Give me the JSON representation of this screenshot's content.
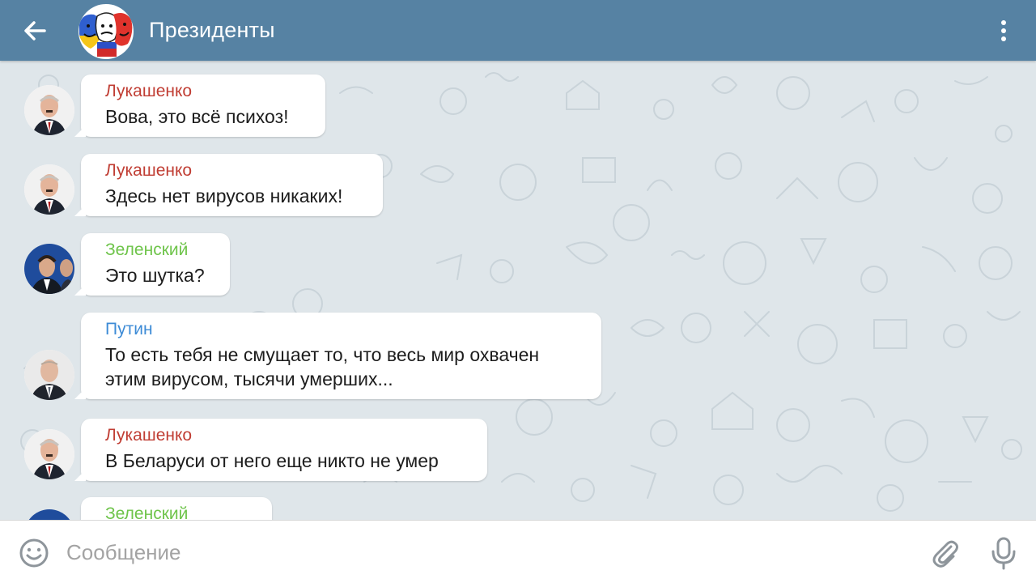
{
  "header": {
    "title": "Президенты",
    "back_icon": "arrow-left-icon",
    "menu_icon": "more-vertical-icon"
  },
  "messages": [
    {
      "sender": "Лукашенко",
      "sender_color": "#c03d33",
      "avatar": "lukashenko-avatar",
      "lines": [
        "Вова, это всё психоз!"
      ]
    },
    {
      "sender": "Лукашенко",
      "sender_color": "#c03d33",
      "avatar": "lukashenko-avatar",
      "lines": [
        "Здесь нет вирусов никаких!"
      ]
    },
    {
      "sender": "Зеленский",
      "sender_color": "#6ec44a",
      "avatar": "zelensky-avatar",
      "lines": [
        "Это шутка?"
      ]
    },
    {
      "sender": "Путин",
      "sender_color": "#3d8bd6",
      "avatar": "putin-avatar",
      "lines": [
        "То есть тебя не смущает то, что весь мир охвачен",
        "этим вирусом, тысячи умерших..."
      ]
    },
    {
      "sender": "Лукашенко",
      "sender_color": "#c03d33",
      "avatar": "lukashenko-avatar",
      "lines": [
        "В Беларуси от него еще никто не умер"
      ]
    },
    {
      "sender": "Зеленский",
      "sender_color": "#6ec44a",
      "avatar": "zelensky-avatar",
      "lines": []
    }
  ],
  "input": {
    "placeholder": "Сообщение",
    "emoji_icon": "smile-icon",
    "attach_icon": "paperclip-icon",
    "mic_icon": "microphone-icon"
  },
  "colors": {
    "header_bg": "#5682a3",
    "chat_bg": "#dfe6ea",
    "bubble_bg": "#ffffff"
  }
}
